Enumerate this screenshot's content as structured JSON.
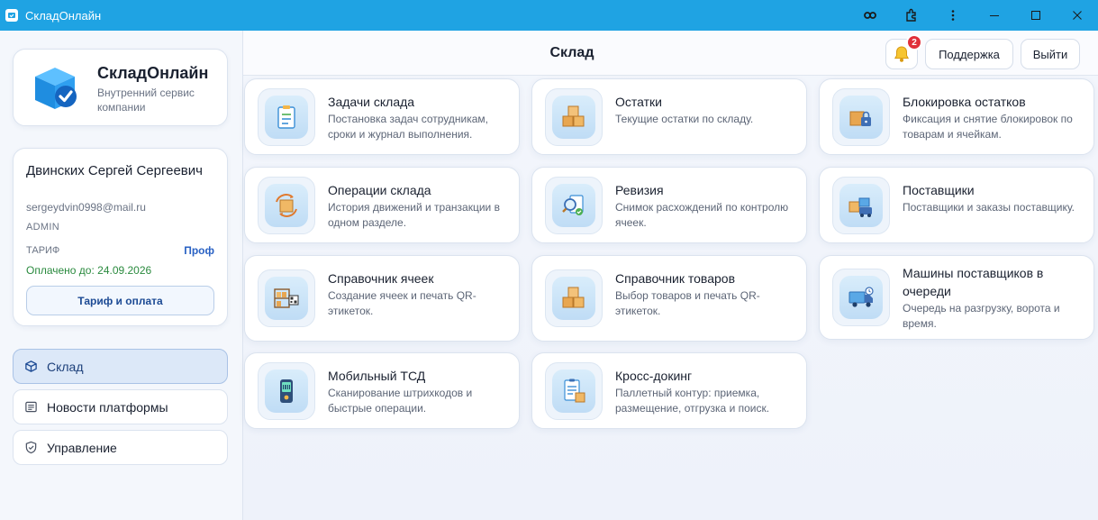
{
  "window": {
    "title": "СкладОнлайн"
  },
  "brand": {
    "name": "СкладОнлайн",
    "subtitle": "Внутренний сервис компании"
  },
  "user": {
    "name": "Двинских Сергей Сергеевич",
    "email": "sergeydvin0998@mail.ru",
    "role": "ADMIN",
    "tariff_label": "ТАРИФ",
    "tariff_value": "Проф",
    "paid_until": "Оплачено до: 24.09.2026",
    "tariff_button": "Тариф и оплата"
  },
  "nav": [
    {
      "label": "Склад",
      "icon": "box-icon",
      "active": true
    },
    {
      "label": "Новости платформы",
      "icon": "news-icon",
      "active": false
    },
    {
      "label": "Управление",
      "icon": "shield-icon",
      "active": false
    }
  ],
  "header": {
    "title": "Склад",
    "notifications_count": "2",
    "support_label": "Поддержка",
    "logout_label": "Выйти"
  },
  "cards": [
    {
      "title": "Задачи склада",
      "desc": "Постановка задач сотрудникам, сроки и журнал выполнения.",
      "icon": "clipboard-icon"
    },
    {
      "title": "Остатки",
      "desc": "Текущие остатки по складу.",
      "icon": "boxes-icon"
    },
    {
      "title": "Блокировка остатков",
      "desc": "Фиксация и снятие блокировок по товарам и ячейкам.",
      "icon": "lock-box-icon"
    },
    {
      "title": "Операции склада",
      "desc": "История движений и транзакции в одном разделе.",
      "icon": "operations-icon"
    },
    {
      "title": "Ревизия",
      "desc": "Снимок расхождений по контролю ячеек.",
      "icon": "audit-icon"
    },
    {
      "title": "Поставщики",
      "desc": "Поставщики и заказы поставщику.",
      "icon": "suppliers-icon"
    },
    {
      "title": "Справочник ячеек",
      "desc": "Создание ячеек и печать QR-этикеток.",
      "icon": "shelf-qr-icon"
    },
    {
      "title": "Справочник товаров",
      "desc": "Выбор товаров и печать QR-этикеток.",
      "icon": "boxes-icon"
    },
    {
      "title": "Машины поставщиков в очереди",
      "desc": "Очередь на разгрузку, ворота и время.",
      "icon": "truck-icon"
    },
    {
      "title": "Мобильный ТСД",
      "desc": "Сканирование штрихкодов и быстрые операции.",
      "icon": "scanner-icon"
    },
    {
      "title": "Кросс-докинг",
      "desc": "Паллетный контур: приемка, размещение, отгрузка и поиск.",
      "icon": "crossdock-icon"
    }
  ]
}
